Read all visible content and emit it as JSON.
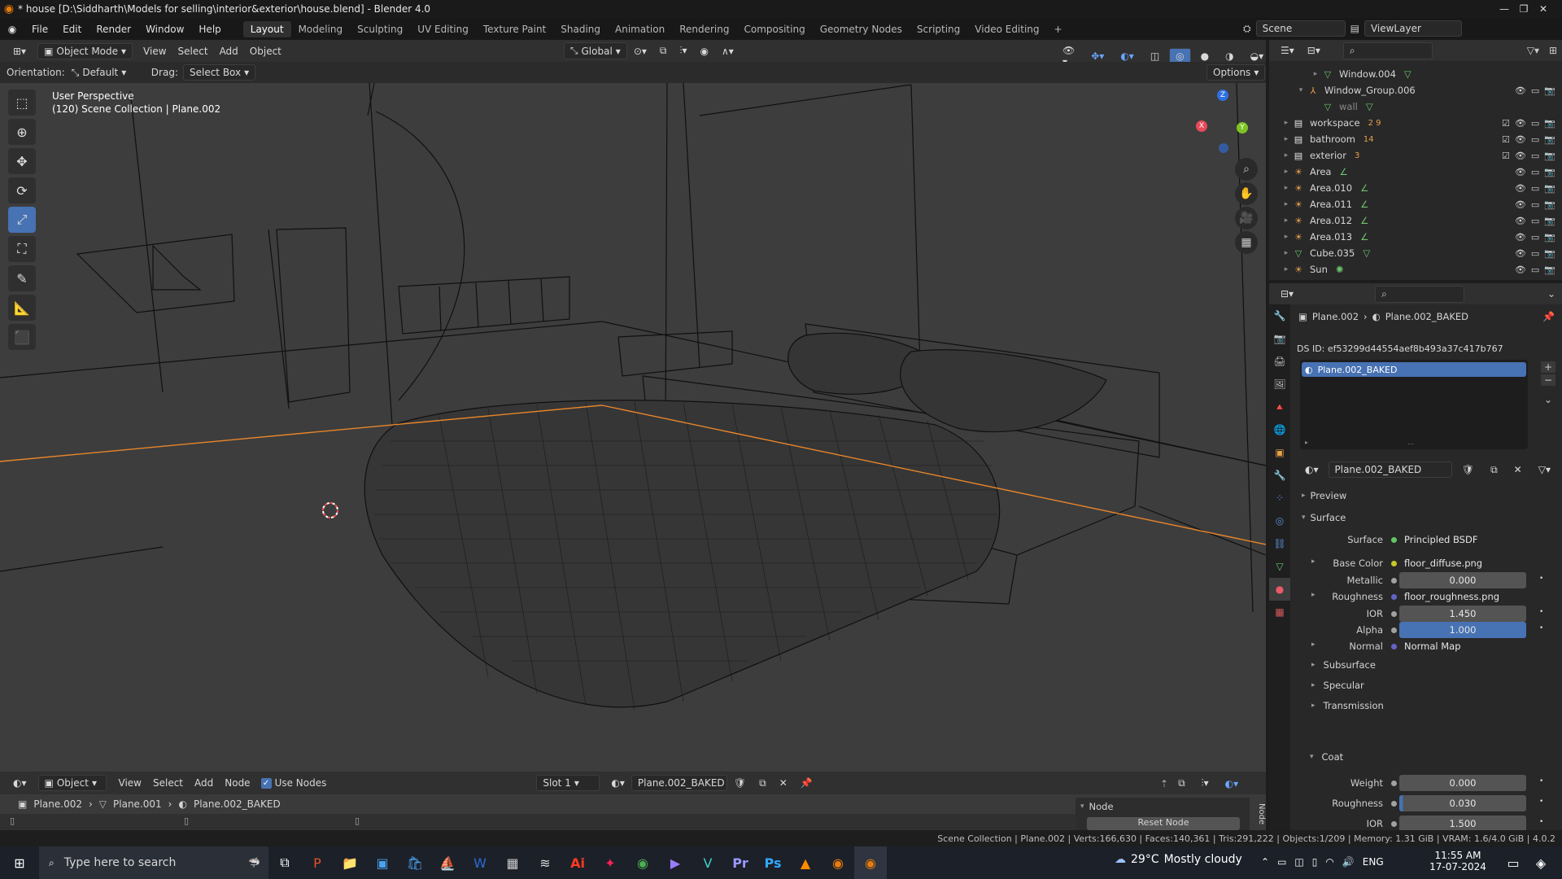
{
  "window": {
    "title": "* house [D:\\Siddharth\\Models for selling\\interior&exterior\\house.blend] - Blender 4.0",
    "min": "—",
    "max": "❐",
    "close": "✕"
  },
  "menu": [
    "File",
    "Edit",
    "Render",
    "Window",
    "Help"
  ],
  "workspaces": [
    "Layout",
    "Modeling",
    "Sculpting",
    "UV Editing",
    "Texture Paint",
    "Shading",
    "Animation",
    "Rendering",
    "Compositing",
    "Geometry Nodes",
    "Scripting",
    "Video Editing"
  ],
  "workspace_add": "+",
  "scene": {
    "scene_name": "Scene",
    "view_layer": "ViewLayer"
  },
  "viewport_header": {
    "mode": "Object Mode",
    "menus": [
      "View",
      "Select",
      "Add",
      "Object"
    ],
    "transform": "Global"
  },
  "viewport_sub": {
    "orientation_label": "Orientation:",
    "orientation_value": "Default",
    "drag_label": "Drag:",
    "drag_value": "Select Box",
    "options": "Options"
  },
  "viewport": {
    "perspective": "User Perspective",
    "collection": "(120) Scene Collection | Plane.002"
  },
  "gizmo": {
    "x": "X",
    "y": "Y",
    "z": "Z"
  },
  "outliner": {
    "search_placeholder": "",
    "items": [
      {
        "name": "Window.004",
        "indent": 3,
        "icon": "mesh-icon",
        "badge": "",
        "arrow": "▸"
      },
      {
        "name": "Window_Group.006",
        "indent": 2,
        "icon": "empty-icon",
        "badge": "",
        "arrow": "▾"
      },
      {
        "name": "wall",
        "indent": 3,
        "icon": "mesh-icon",
        "badge": "",
        "arrow": ""
      },
      {
        "name": "workspace",
        "indent": 1,
        "icon": "collection-icon",
        "badge": "2 9",
        "arrow": "▸"
      },
      {
        "name": "bathroom",
        "indent": 1,
        "icon": "collection-icon",
        "badge": "14",
        "arrow": "▸"
      },
      {
        "name": "exterior",
        "indent": 1,
        "icon": "collection-icon",
        "badge": "3",
        "arrow": "▸"
      },
      {
        "name": "Area",
        "indent": 1,
        "icon": "light-icon",
        "badge": "",
        "arrow": "▸"
      },
      {
        "name": "Area.010",
        "indent": 1,
        "icon": "light-icon",
        "badge": "",
        "arrow": "▸"
      },
      {
        "name": "Area.011",
        "indent": 1,
        "icon": "light-icon",
        "badge": "",
        "arrow": "▸"
      },
      {
        "name": "Area.012",
        "indent": 1,
        "icon": "light-icon",
        "badge": "",
        "arrow": "▸"
      },
      {
        "name": "Area.013",
        "indent": 1,
        "icon": "light-icon",
        "badge": "",
        "arrow": "▸"
      },
      {
        "name": "Cube.035",
        "indent": 1,
        "icon": "mesh-icon",
        "badge": "",
        "arrow": "▸"
      },
      {
        "name": "Sun",
        "indent": 1,
        "icon": "sun-icon",
        "badge": "",
        "arrow": "▸"
      }
    ]
  },
  "properties": {
    "breadcrumb_object": "Plane.002",
    "breadcrumb_material": "Plane.002_BAKED",
    "ds_id": "DS ID: ef53299d44554aef8b493a37c417b767",
    "slot_selected": "Plane.002_BAKED",
    "material_name": "Plane.002_BAKED",
    "preview": "Preview",
    "surface_panel": "Surface",
    "fields": [
      {
        "label": "Surface",
        "value": "Principled BSDF",
        "kind": "link",
        "dot": "#63c763"
      },
      {
        "label": "Base Color",
        "value": "floor_diffuse.png",
        "kind": "link",
        "dot": "#c7c729",
        "expand": "▸"
      },
      {
        "label": "Metallic",
        "value": "0.000",
        "kind": "num",
        "dot": "#a1a1a1",
        "fill": 0
      },
      {
        "label": "Roughness",
        "value": "floor_roughness.png",
        "kind": "link",
        "dot": "#6363c7",
        "expand": "▸"
      },
      {
        "label": "IOR",
        "value": "1.450",
        "kind": "num",
        "dot": "#a1a1a1",
        "fill": 0
      },
      {
        "label": "Alpha",
        "value": "1.000",
        "kind": "num",
        "dot": "#a1a1a1",
        "fill": 1
      },
      {
        "label": "Normal",
        "value": "Normal Map",
        "kind": "link",
        "dot": "#6363c7",
        "expand": "▸"
      }
    ],
    "subpanels": [
      "Subsurface",
      "Specular",
      "Transmission"
    ],
    "coat_panel": "Coat",
    "coat_fields": [
      {
        "label": "Weight",
        "value": "0.000",
        "fill": 0
      },
      {
        "label": "Roughness",
        "value": "0.030",
        "fill": 0.03
      },
      {
        "label": "IOR",
        "value": "1.500",
        "fill": 0
      }
    ]
  },
  "node_editor": {
    "type": "Object",
    "menus": [
      "View",
      "Select",
      "Add",
      "Node"
    ],
    "use_nodes": "Use Nodes",
    "slot": "Slot 1",
    "material": "Plane.002_BAKED",
    "crumbs": [
      "Plane.002",
      "Plane.001",
      "Plane.002_BAKED"
    ],
    "node_panel": "Node",
    "reset": "Reset Node",
    "tab": "Node"
  },
  "status": {
    "text": "Scene Collection | Plane.002 | Verts:166,630 | Faces:140,361 | Tris:291,222 | Objects:1/209 | Memory: 1.31 GiB | VRAM: 1.6/4.0 GiB | 4.0.2"
  },
  "taskbar": {
    "search_placeholder": "Type here to search",
    "weather_temp": "29°C",
    "weather_text": "Mostly cloudy",
    "lang": "ENG",
    "time": "11:55 AM",
    "date": "17-07-2024"
  }
}
